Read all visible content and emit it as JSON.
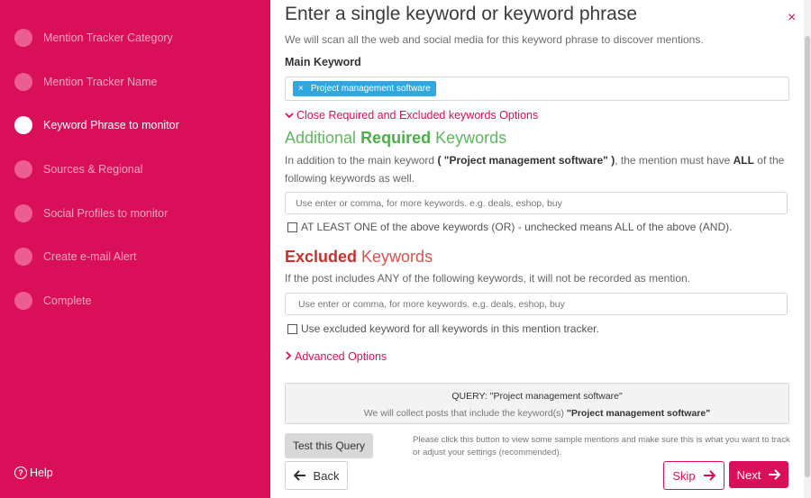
{
  "sidebar": {
    "steps": [
      {
        "label": "Mention Tracker Category"
      },
      {
        "label": "Mention Tracker Name"
      },
      {
        "label": "Keyword Phrase to monitor"
      },
      {
        "label": "Sources & Regional"
      },
      {
        "label": "Social Profiles to monitor"
      },
      {
        "label": "Create e-mail Alert"
      },
      {
        "label": "Complete"
      }
    ],
    "active_step": "Keyword Phrase to monitor",
    "help_label": "Help"
  },
  "header": {
    "title": "Enter a single keyword or keyword phrase",
    "subtitle": "We will scan all the web and social media for this keyword phrase to discover mentions.",
    "close_glyph": "×"
  },
  "main_keyword": {
    "label": "Main Keyword",
    "tag_remove": "×",
    "tag": "Project management software"
  },
  "toggle_link": "Close Required and Excluded keywords Options",
  "required": {
    "title_pre": "Additional ",
    "title_bold": "Required",
    "title_post": " Keywords",
    "desc_1": "In addition to the main keyword ",
    "desc_keyword": "( \"Project management software\" )",
    "desc_2": ", the mention must have ",
    "desc_all": "ALL",
    "desc_3": " of the following keywords as well.",
    "placeholder": "Use enter or comma, for more keywords. e.g. deals, eshop, buy",
    "checkbox_label": "AT LEAST ONE of the above keywords (OR) - unchecked means ALL of the above (AND)."
  },
  "excluded": {
    "title_bold": "Excluded",
    "title_post": " Keywords",
    "desc": "If the post includes ANY of the following keywords, it will not be recorded as mention.",
    "placeholder": "Use enter or comma, for more keywords. e.g. deals, eshop, buy",
    "checkbox_label": "Use excluded keyword for all keywords in this mention tracker."
  },
  "advanced_link": "Advanced Options",
  "query": {
    "line1": "QUERY:  \"Project management software\"",
    "line2_pre": "We will collect posts that include the keyword(s) ",
    "line2_bold": "\"Project management software\""
  },
  "actions": {
    "test_label": "Test this Query",
    "hint": "Please click this button to view some sample mentions and make sure this is what you want to track or adjust your settings (recommended).",
    "back_label": "Back",
    "skip_label": "Skip",
    "next_label": "Next"
  },
  "colors": {
    "brand": "#d90f5a",
    "required_green": "#5cb85c",
    "excluded_red": "#d9534f",
    "tag_blue": "#2fa7e0"
  }
}
